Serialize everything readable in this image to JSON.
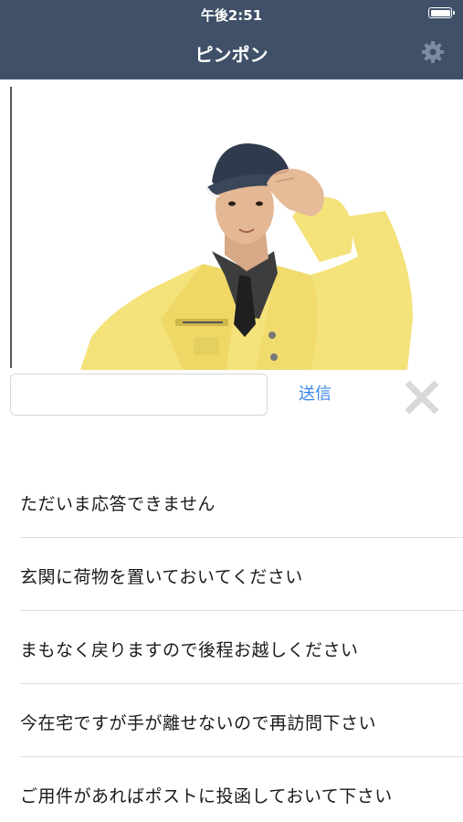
{
  "status_bar": {
    "time": "午後2:51",
    "battery_icon": "battery-icon"
  },
  "nav": {
    "title": "ピンポン",
    "settings_icon": "gear-icon",
    "background_color": "#3f5068"
  },
  "camera": {
    "subject": "camera-photo"
  },
  "reply_bar": {
    "input_value": "",
    "input_placeholder": "",
    "send_label": "送信",
    "close_icon": "close-icon",
    "accent_color": "#3a86e6"
  },
  "quick_replies": [
    {
      "label": "ただいま応答できません"
    },
    {
      "label": "玄関に荷物を置いておいてください"
    },
    {
      "label": "まもなく戻りますので後程お越しください"
    },
    {
      "label": "今在宅ですが手が離せないので再訪問下さい"
    },
    {
      "label": "ご用件があればポストに投函しておいて下さい"
    }
  ]
}
